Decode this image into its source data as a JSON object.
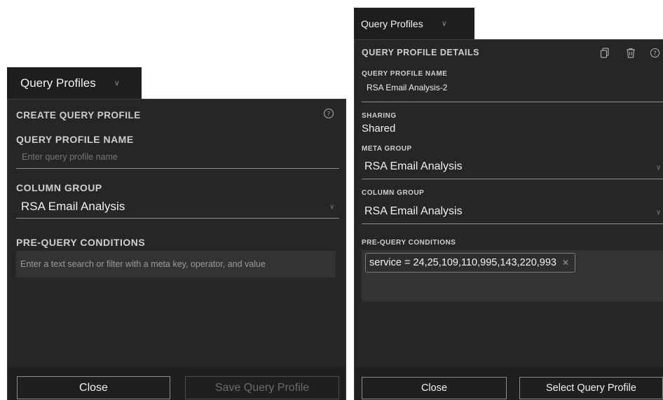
{
  "left": {
    "tab_label": "Query Profiles",
    "panel_title": "CREATE QUERY PROFILE",
    "name_label": "QUERY PROFILE NAME",
    "name_placeholder": "Enter query profile name",
    "column_group_label": "COLUMN GROUP",
    "column_group_value": "RSA Email Analysis",
    "prequery_label": "PRE-QUERY CONDITIONS",
    "prequery_placeholder": "Enter a text search or filter with a meta key, operator, and value",
    "close_label": "Close",
    "save_label": "Save Query Profile"
  },
  "right": {
    "tab_label": "Query Profiles",
    "panel_title": "QUERY PROFILE DETAILS",
    "name_label": "QUERY PROFILE NAME",
    "name_value": "RSA Email Analysis-2",
    "sharing_label": "SHARING",
    "sharing_value": "Shared",
    "meta_group_label": "META GROUP",
    "meta_group_value": "RSA Email Analysis",
    "column_group_label": "COLUMN GROUP",
    "column_group_value": "RSA Email Analysis",
    "prequery_label": "PRE-QUERY CONDITIONS",
    "condition_pill": "service = 24,25,109,110,995,143,220,993",
    "close_label": "Close",
    "select_label": "Select Query Profile"
  },
  "icons": {
    "help": "help-circle-icon",
    "copy": "copy-icon",
    "delete": "trash-icon",
    "chevron": "chevron-down-icon",
    "remove": "close-icon"
  },
  "colors": {
    "panel_bg": "#262626",
    "tab_bg": "#1e1e1e",
    "input_bg": "#333333",
    "disabled_text": "#6b6b6b"
  }
}
